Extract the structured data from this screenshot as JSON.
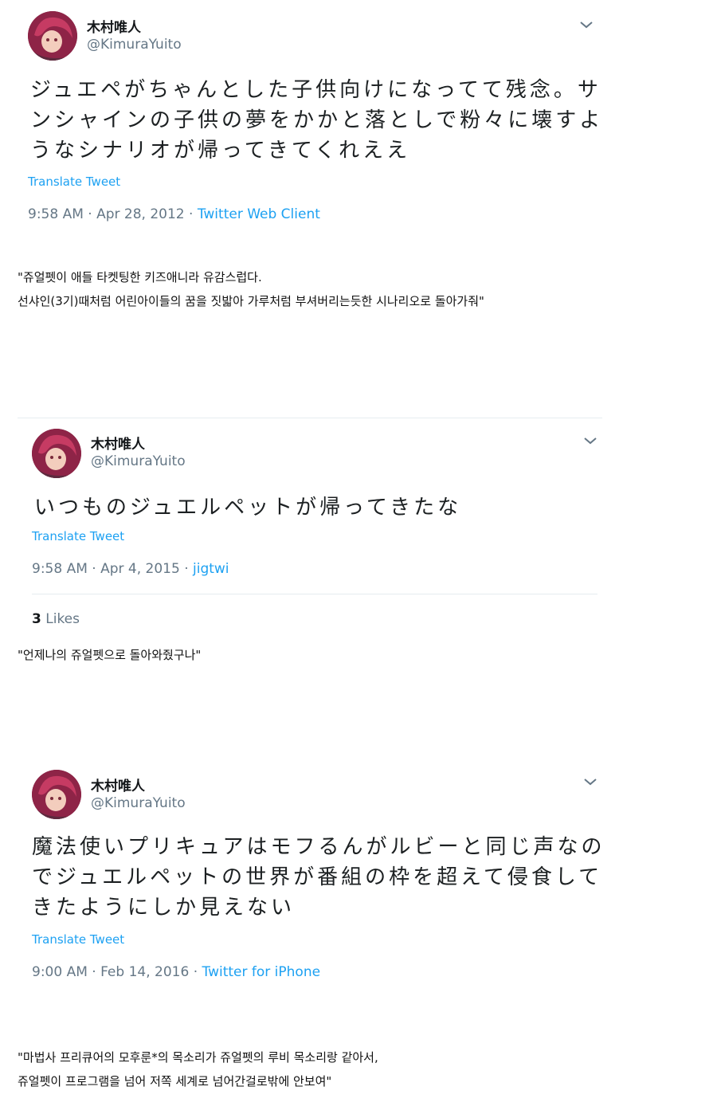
{
  "tweets": [
    {
      "name": "木村唯人",
      "handle": "@KimuraYuito",
      "lines": [
        "ジュエペがちゃんとした子供向けになってて残念。サ",
        "ンシャインの子供の夢をかかと落としで粉々に壊すよ",
        "うなシナリオが帰ってきてくれええ"
      ],
      "translate": "Translate Tweet",
      "time": "9:58 AM · Apr 28, 2012 · ",
      "source": "Twitter Web Client"
    },
    {
      "name": "木村唯人",
      "handle": "@KimuraYuito",
      "lines": [
        "いつものジュエルペットが帰ってきたな"
      ],
      "translate": "Translate Tweet",
      "time": "9:58 AM · Apr 4, 2015 · ",
      "source": "jigtwi",
      "likes_count": "3",
      "likes_label": "Likes"
    },
    {
      "name": "木村唯人",
      "handle": "@KimuraYuito",
      "lines": [
        "魔法使いプリキュアはモフるんがルビーと同じ声なの",
        "でジュエルペットの世界が番組の枠を超えて侵食して",
        "きたようにしか見えない"
      ],
      "translate": "Translate Tweet",
      "time": "9:00 AM · Feb 14, 2016 · ",
      "source": "Twitter for iPhone"
    }
  ],
  "notes": [
    [
      "\"쥬얼펫이 애들 타켓팅한 키즈애니라 유감스럽다.",
      "선샤인(3기)때처럼 어린아이들의 꿈을 짓밟아 가루처럼 부셔버리는듯한 시나리오로 돌아가줘\""
    ],
    [
      "\"언제나의 쥬얼펫으로 돌아와줬구나\""
    ],
    [
      "\"마법사 프리큐어의 모후룬*의 목소리가 쥬얼펫의 루비 목소리랑 같아서,",
      "쥬얼펫이 프로그램을 넘어 저쪽 세계로 넘어간걸로밖에 안보여\""
    ]
  ]
}
